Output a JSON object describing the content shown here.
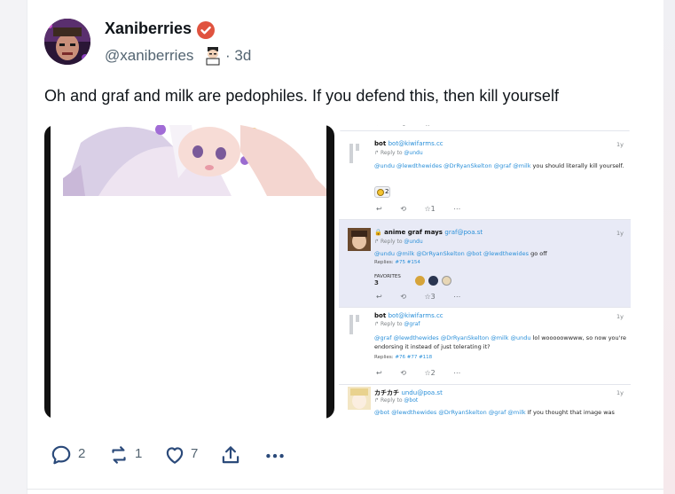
{
  "post": {
    "display_name": "Xaniberries",
    "handle": "@xaniberries",
    "time": "· 3d",
    "text": "Oh and graf and milk are pedophiles. If you defend this, then kill yourself",
    "actions": {
      "replies": "2",
      "reposts": "1",
      "likes": "7"
    }
  },
  "embedded_thread": {
    "entries": [
      {
        "name": "bot",
        "acct": "bot@kiwifarms.cc",
        "reply_to": "@undu",
        "time": "1y",
        "mentions": "@undu @lewdthewides @DrRyanSkelton @graf @milk",
        "body": " you should literally kill yourself.",
        "reaction_count": "2",
        "fav_count": "1"
      },
      {
        "name": "anime graf mays",
        "acct": "graf@poa.st",
        "reply_to": "@undu",
        "time": "1y",
        "mentions": "@undu @milk @DrRyanSkelton @bot @lewdthewides",
        "body": " go off",
        "replies_label": "Replies:",
        "replies_refs": "#75 #154",
        "favorites_label": "FAVORITES",
        "favorites_count": "3",
        "fav_count": "3"
      },
      {
        "name": "bot",
        "acct": "bot@kiwifarms.cc",
        "reply_to": "@graf",
        "time": "1y",
        "mentions": "@graf @lewdthewides @DrRyanSkelton @milk @undu",
        "body": " lol wooooowwww, so now you're endorsing it instead of just tolerating it?",
        "replies_label": "Replies:",
        "replies_refs": "#76 #77 #118",
        "fav_count": "2"
      },
      {
        "name": "カチカチ",
        "acct": "undu@poa.st",
        "reply_to": "@bot",
        "time": "1y",
        "mentions": "@bot @lewdthewides @DrRyanSkelton @graf @milk",
        "body": " If you thought that image was"
      }
    ],
    "reply_label": "Reply to",
    "action_icons": "↩ ⟲ ☆"
  },
  "icons": {
    "avatar": "avatar",
    "verified": "verified-badge-icon",
    "reply": "reply-icon",
    "repost": "repost-icon",
    "like": "heart-icon",
    "share": "share-icon",
    "more": "more-icon",
    "globe": "globe-icon",
    "lock": "lock-icon"
  },
  "colors": {
    "accent_verified": "#e0533f",
    "text_primary": "#0f1419",
    "text_secondary": "#536471",
    "mention": "#2b90d9",
    "highlight_row": "#e8eaf6"
  }
}
